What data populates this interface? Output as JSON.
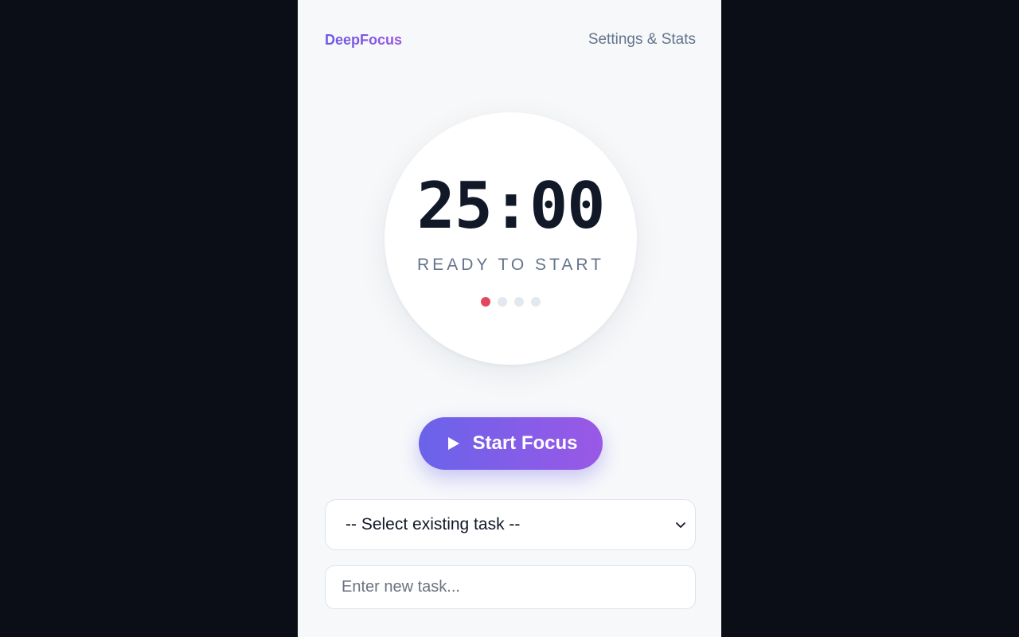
{
  "header": {
    "brand": "DeepFocus",
    "nav_link": "Settings & Stats"
  },
  "timer": {
    "display": "25:00",
    "status": "READY TO START",
    "session_dots": {
      "total": 4,
      "completed": 1
    }
  },
  "controls": {
    "start_label": "Start Focus",
    "start_icon": "play-icon"
  },
  "task": {
    "select_value": "-- Select existing task --",
    "select_icon": "chevron-down-icon",
    "input_value": "",
    "input_placeholder": "Enter new task..."
  },
  "colors": {
    "brand_gradient_start": "#6b5ae8",
    "brand_gradient_end": "#9b54e2",
    "dot_active": "#e3475f",
    "dot_inactive": "#e2e8f0",
    "page_background": "#f6f8fa",
    "outer_background": "#0b0e16"
  }
}
